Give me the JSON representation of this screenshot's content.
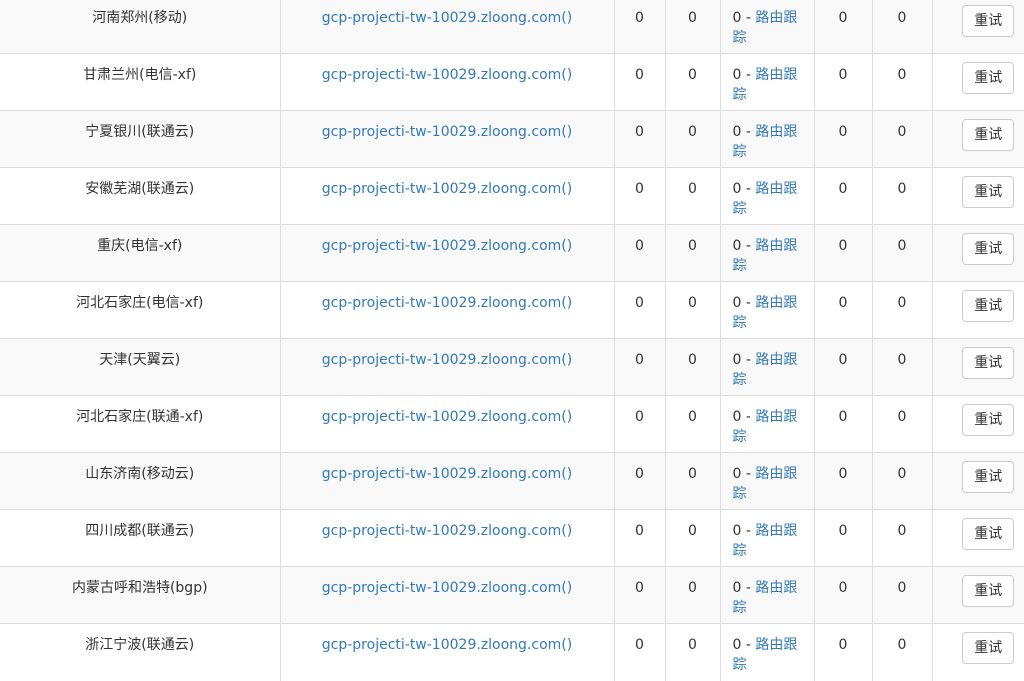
{
  "rows": [
    {
      "location": "河南郑州(移动)",
      "host": "gcp-projecti-tw-10029.zloong.com",
      "host_suffix": "()",
      "col1": "0",
      "col2": "0",
      "trace_value": "0",
      "trace_sep": " - ",
      "trace_label": "路由跟踪",
      "col4": "0",
      "col5": "0",
      "button": "重试"
    },
    {
      "location": "甘肃兰州(电信-xf)",
      "host": "gcp-projecti-tw-10029.zloong.com",
      "host_suffix": "()",
      "col1": "0",
      "col2": "0",
      "trace_value": "0",
      "trace_sep": " - ",
      "trace_label": "路由跟踪",
      "col4": "0",
      "col5": "0",
      "button": "重试"
    },
    {
      "location": "宁夏银川(联通云)",
      "host": "gcp-projecti-tw-10029.zloong.com",
      "host_suffix": "()",
      "col1": "0",
      "col2": "0",
      "trace_value": "0",
      "trace_sep": " - ",
      "trace_label": "路由跟踪",
      "col4": "0",
      "col5": "0",
      "button": "重试"
    },
    {
      "location": "安徽芜湖(联通云)",
      "host": "gcp-projecti-tw-10029.zloong.com",
      "host_suffix": "()",
      "col1": "0",
      "col2": "0",
      "trace_value": "0",
      "trace_sep": " - ",
      "trace_label": "路由跟踪",
      "col4": "0",
      "col5": "0",
      "button": "重试"
    },
    {
      "location": "重庆(电信-xf)",
      "host": "gcp-projecti-tw-10029.zloong.com",
      "host_suffix": "()",
      "col1": "0",
      "col2": "0",
      "trace_value": "0",
      "trace_sep": " - ",
      "trace_label": "路由跟踪",
      "col4": "0",
      "col5": "0",
      "button": "重试"
    },
    {
      "location": "河北石家庄(电信-xf)",
      "host": "gcp-projecti-tw-10029.zloong.com",
      "host_suffix": "()",
      "col1": "0",
      "col2": "0",
      "trace_value": "0",
      "trace_sep": " - ",
      "trace_label": "路由跟踪",
      "col4": "0",
      "col5": "0",
      "button": "重试"
    },
    {
      "location": "天津(天翼云)",
      "host": "gcp-projecti-tw-10029.zloong.com",
      "host_suffix": "()",
      "col1": "0",
      "col2": "0",
      "trace_value": "0",
      "trace_sep": " - ",
      "trace_label": "路由跟踪",
      "col4": "0",
      "col5": "0",
      "button": "重试"
    },
    {
      "location": "河北石家庄(联通-xf)",
      "host": "gcp-projecti-tw-10029.zloong.com",
      "host_suffix": "()",
      "col1": "0",
      "col2": "0",
      "trace_value": "0",
      "trace_sep": " - ",
      "trace_label": "路由跟踪",
      "col4": "0",
      "col5": "0",
      "button": "重试"
    },
    {
      "location": "山东济南(移动云)",
      "host": "gcp-projecti-tw-10029.zloong.com",
      "host_suffix": "()",
      "col1": "0",
      "col2": "0",
      "trace_value": "0",
      "trace_sep": " - ",
      "trace_label": "路由跟踪",
      "col4": "0",
      "col5": "0",
      "button": "重试"
    },
    {
      "location": "四川成都(联通云)",
      "host": "gcp-projecti-tw-10029.zloong.com",
      "host_suffix": "()",
      "col1": "0",
      "col2": "0",
      "trace_value": "0",
      "trace_sep": " - ",
      "trace_label": "路由跟踪",
      "col4": "0",
      "col5": "0",
      "button": "重试"
    },
    {
      "location": "内蒙古呼和浩特(bgp)",
      "host": "gcp-projecti-tw-10029.zloong.com",
      "host_suffix": "()",
      "col1": "0",
      "col2": "0",
      "trace_value": "0",
      "trace_sep": " - ",
      "trace_label": "路由跟踪",
      "col4": "0",
      "col5": "0",
      "button": "重试"
    },
    {
      "location": "浙江宁波(联通云)",
      "host": "gcp-projecti-tw-10029.zloong.com",
      "host_suffix": "()",
      "col1": "0",
      "col2": "0",
      "trace_value": "0",
      "trace_sep": " - ",
      "trace_label": "路由跟踪",
      "col4": "0",
      "col5": "0",
      "button": "重试"
    }
  ],
  "colors": {
    "link": "#337ab7",
    "stripe": "#f9f9f9",
    "border": "#dddddd",
    "text": "#333333"
  }
}
